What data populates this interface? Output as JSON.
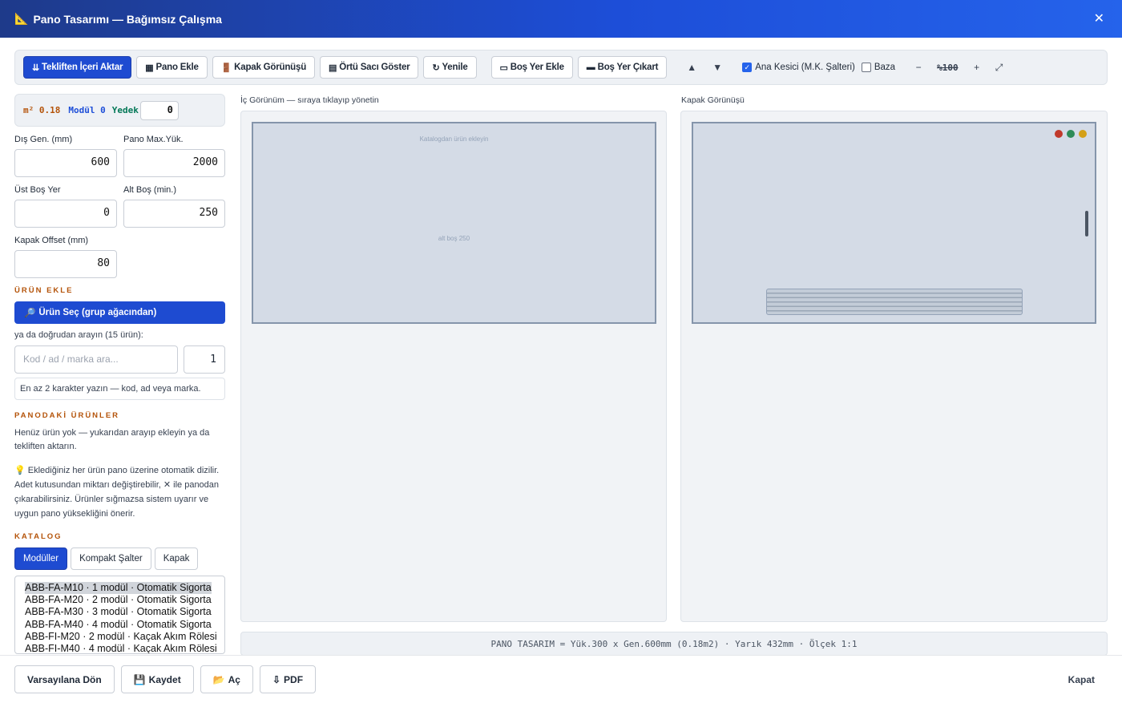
{
  "window": {
    "title_icon": "📐",
    "title": "Pano Tasarımı — Bağımsız Çalışma",
    "close": "✕"
  },
  "toolbar": {
    "import": {
      "icon": "⇊",
      "label": "Tekliften İçeri Aktar"
    },
    "add_panel": {
      "icon": "▦",
      "label": "Pano Ekle"
    },
    "cover_view": {
      "icon": "🚪",
      "label": "Kapak Görünüşü"
    },
    "cover_sheet": {
      "icon": "▤",
      "label": "Örtü Sacı Göster"
    },
    "refresh": {
      "icon": "↻",
      "label": "Yenile"
    },
    "add_space": {
      "icon": "▭",
      "label": "Boş Yer Ekle"
    },
    "remove_space": {
      "icon": "▬",
      "label": "Boş Yer Çıkart"
    },
    "up": "▲",
    "down": "▼",
    "main_breaker": {
      "label": "Ana Kesici (M.K. Şalteri)",
      "checked": true
    },
    "baza": {
      "label": "Baza",
      "checked": false
    },
    "zoom_out": "−",
    "zoom": "%100",
    "zoom_in": "+",
    "fullscreen": "⤢"
  },
  "stats": {
    "m2_label": "m² 0.18",
    "modul_label": "Modül 0",
    "yedek_label": "Yedek",
    "yedek_value": "0"
  },
  "fields": {
    "dis_gen": {
      "label": "Dış Gen. (mm)",
      "value": "600"
    },
    "pano_max": {
      "label": "Pano Max.Yük.",
      "value": "2000"
    },
    "ust_bos": {
      "label": "Üst Boş Yer",
      "value": "0"
    },
    "alt_bos": {
      "label": "Alt Boş (min.)",
      "value": "250"
    },
    "kapak_offset": {
      "label": "Kapak Offset (mm)",
      "value": "80"
    }
  },
  "urun_ekle": {
    "heading": "ÜRÜN EKLE",
    "select_button": {
      "icon": "🔎",
      "label": "Ürün Seç (grup ağacından)"
    },
    "search_hint": "ya da doğrudan arayın (15 ürün):",
    "search_placeholder": "Kod / ad / marka ara...",
    "qty": "1",
    "min_hint": "En az 2 karakter yazın — kod, ad veya marka."
  },
  "panodaki": {
    "heading": "PANODAKİ ÜRÜNLER",
    "empty": "Henüz ürün yok — yukarıdan arayıp ekleyin ya da tekliften aktarın.",
    "tip": "💡 Eklediğiniz her ürün pano üzerine otomatik dizilir. Adet kutusundan miktarı değiştirebilir, ✕ ile panodan çıkarabilirsiniz. Ürünler sığmazsa sistem uyarır ve uygun pano yüksekliğini önerir."
  },
  "katalog": {
    "heading": "KATALOG",
    "tabs": [
      "Modüller",
      "Kompakt Şalter",
      "Kapak"
    ],
    "active_tab": 0,
    "items": [
      "ABB-FA-M10 · 1 modül · Otomatik Sigorta",
      "ABB-FA-M20 · 2 modül · Otomatik Sigorta",
      "ABB-FA-M30 · 3 modül · Otomatik Sigorta",
      "ABB-FA-M40 · 4 modül · Otomatik Sigorta",
      "ABB-FI-M20 · 2 modül · Kaçak Akım Rölesi",
      "ABB-FI-M40 · 4 modül · Kaçak Akım Rölesi"
    ]
  },
  "inner_view": {
    "label": "İç Görünüm — sıraya tıklayıp yönetin",
    "empty_text": "Katalogdan ürün ekleyin",
    "bottom_text": "alt boş 250"
  },
  "cover_view": {
    "label": "Kapak Görünüşü",
    "light_colors": [
      "#c0392b",
      "#2e8b57",
      "#d4a017"
    ]
  },
  "statusbar": "PANO TASARIM = Yük.300 x Gen.600mm (0.18m2) · Yarık 432mm · Ölçek 1:1",
  "footer": {
    "reset": "Varsayılana Dön",
    "save": {
      "icon": "💾",
      "label": "Kaydet"
    },
    "open": {
      "icon": "📂",
      "label": "Aç"
    },
    "pdf": {
      "icon": "⇩",
      "label": "PDF"
    },
    "close": "Kapat"
  }
}
